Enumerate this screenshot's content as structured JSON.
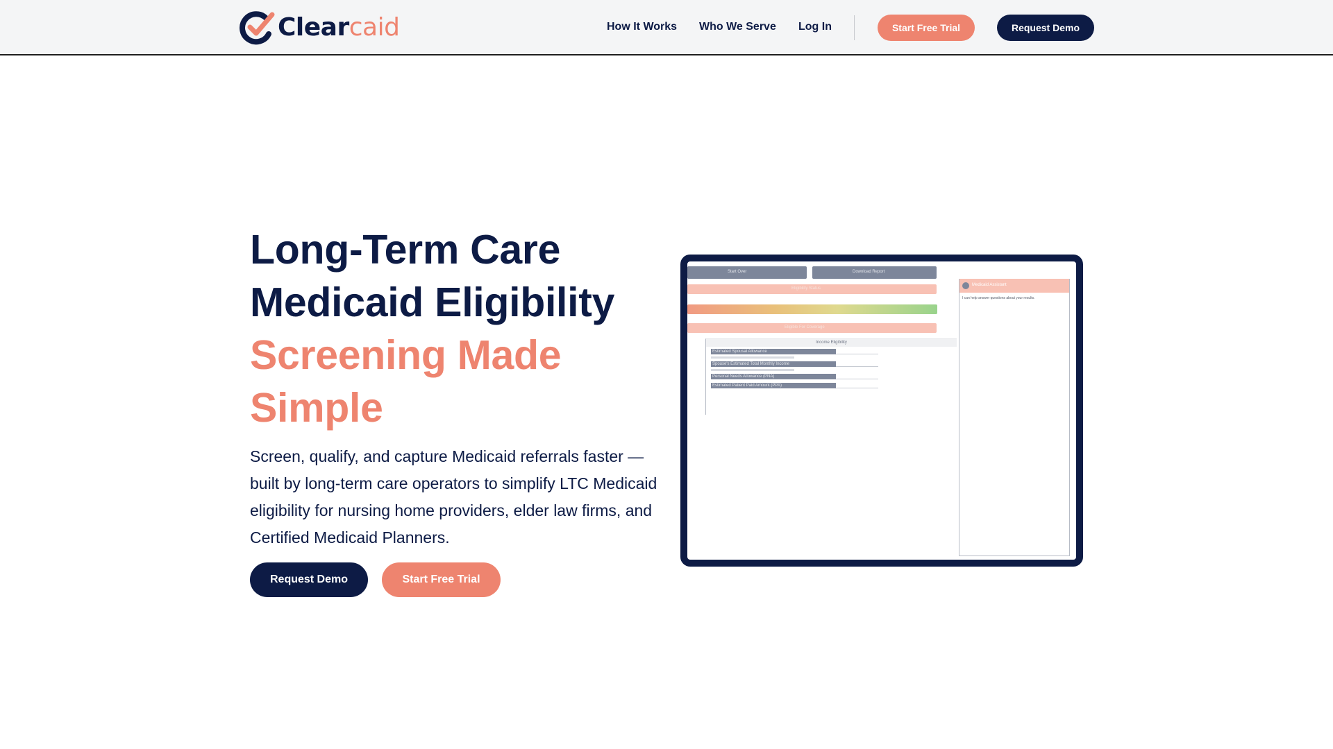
{
  "brand": {
    "name_part1": "Clear",
    "name_part2": "caid",
    "colors": {
      "navy": "#0d1b45",
      "coral": "#ee846f"
    }
  },
  "nav": {
    "links": [
      "How It Works",
      "Who We Serve",
      "Log In"
    ],
    "start_trial": "Start Free Trial",
    "request_demo": "Request Demo"
  },
  "hero": {
    "title_line1": "Long-Term Care",
    "title_line2": "Medicaid Eligibility",
    "title_line3": "Screening Made",
    "title_line4": "Simple",
    "description": "Screen, qualify, and capture Medicaid referrals faster — built by long-term care operators to simplify LTC Medicaid eligibility for nursing home providers, elder law firms, and Certified Medicaid Planners.",
    "primary_button": "Request Demo",
    "secondary_button": "Start Free Trial"
  },
  "mockup": {
    "start_over": "Start Over",
    "download_report": "Download Report",
    "status_1": "Eligibility Status",
    "status_2": "Eligible For Coverage",
    "panel_title": "Income Eligibility",
    "rows": [
      "Estimated Spousal Allowance",
      "Spouse's Estimated Total Monthly Income",
      "Personal Needs Allowance (PNA)",
      "Estimated Patient Paid Amount (PPA)"
    ],
    "assistant_title": "Medicaid Assistant",
    "assistant_message": "I can help answer questions about your results."
  }
}
